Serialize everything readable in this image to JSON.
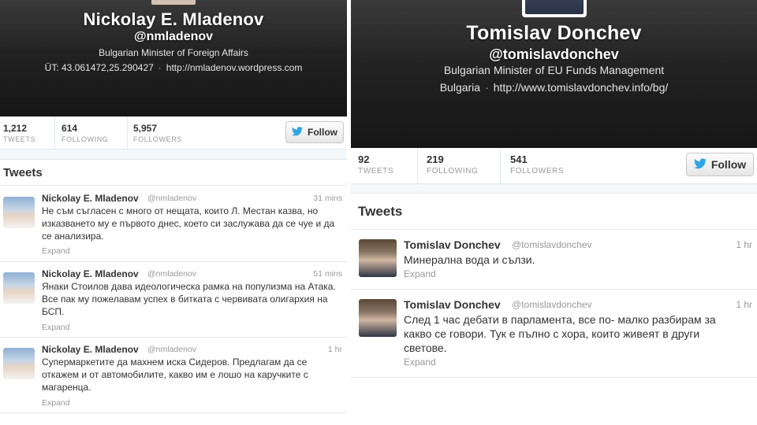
{
  "left_profile": {
    "name": "Nickolay E. Mladenov",
    "handle": "@nmladenov",
    "bio": "Bulgarian Minister of Foreign Affairs",
    "location": "ÜT: 43.061472,25.290427",
    "location_sep": "·",
    "url": "http://nmladenov.wordpress.com",
    "stats": [
      {
        "value": "1,212",
        "label": "TWEETS"
      },
      {
        "value": "614",
        "label": "FOLLOWING"
      },
      {
        "value": "5,957",
        "label": "FOLLOWERS"
      }
    ],
    "follow_label": "Follow",
    "tweets_heading": "Tweets",
    "tweets": [
      {
        "name": "Nickolay E. Mladenov",
        "handle": "@nmladenov",
        "time": "31 mins",
        "text": "Не съм съгласен с много от нещата, които Л. Местан казва, но изказването му е първото днес, което си заслужава да се чуе и да се анализира.",
        "expand": "Expand"
      },
      {
        "name": "Nickolay E. Mladenov",
        "handle": "@nmladenov",
        "time": "51 mins",
        "text": "Янаки Стоилов дава идеологическа рамка на популизма на Атака. Все пак му пожелавам успех в битката с червивата олигархия на БСП.",
        "expand": "Expand"
      },
      {
        "name": "Nickolay E. Mladenov",
        "handle": "@nmladenov",
        "time": "1 hr",
        "text": "Супермаркетите да махнем иска Сидеров. Предлагам да се откажем и от автомобилите, какво им е лошо на каручките с магаренца.",
        "expand": "Expand"
      }
    ]
  },
  "right_profile": {
    "name": "Tomislav Donchev",
    "handle": "@tomislavdonchev",
    "bio": "Bulgarian Minister of EU Funds Management",
    "location": "Bulgaria",
    "location_sep": "·",
    "url": "http://www.tomislavdonchev.info/bg/",
    "stats": [
      {
        "value": "92",
        "label": "TWEETS"
      },
      {
        "value": "219",
        "label": "FOLLOWING"
      },
      {
        "value": "541",
        "label": "FOLLOWERS"
      }
    ],
    "follow_label": "Follow",
    "tweets_heading": "Tweets",
    "tweets": [
      {
        "name": "Tomislav Donchev",
        "handle": "@tomislavdonchev",
        "time": "1 hr",
        "text": "Минерална вода и сълзи.",
        "expand": "Expand"
      },
      {
        "name": "Tomislav Donchev",
        "handle": "@tomislavdonchev",
        "time": "1 hr",
        "text": "След 1 час дебати в парламента, все по- малко разбирам за какво се говори. Тук е пълно с хора, които живеят в други светове.",
        "expand": "Expand"
      }
    ]
  },
  "icons": {
    "follow": "twitter-bird-icon"
  },
  "colors": {
    "twitter_blue": "#2fa5e4",
    "header_dark": "#1c1c1c",
    "muted": "#999999"
  }
}
